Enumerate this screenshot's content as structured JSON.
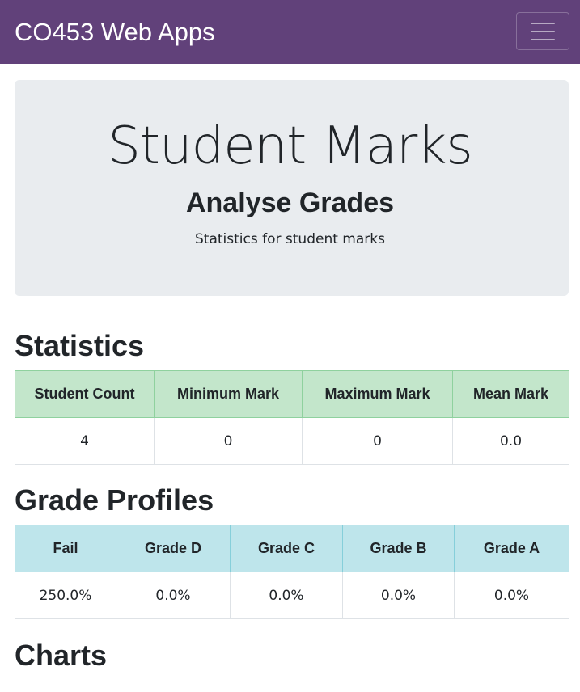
{
  "navbar": {
    "brand": "CO453 Web Apps",
    "toggler_icon": "hamburger-menu-icon"
  },
  "jumbotron": {
    "title": "Student Marks",
    "subtitle": "Analyse Grades",
    "lead": "Statistics for student marks"
  },
  "statistics": {
    "heading": "Statistics",
    "headers": [
      "Student Count",
      "Minimum Mark",
      "Maximum Mark",
      "Mean Mark"
    ],
    "values": [
      "4",
      "0",
      "0",
      "0.0"
    ]
  },
  "grade_profiles": {
    "heading": "Grade Profiles",
    "headers": [
      "Fail",
      "Grade D",
      "Grade C",
      "Grade B",
      "Grade A"
    ],
    "values": [
      "250.0%",
      "0.0%",
      "0.0%",
      "0.0%",
      "0.0%"
    ]
  },
  "charts": {
    "heading": "Charts"
  },
  "colors": {
    "navbar": "#61417a",
    "jumbotron": "#e9ecef",
    "stats_header": "#c3e6cb",
    "grades_header": "#bee5eb"
  }
}
